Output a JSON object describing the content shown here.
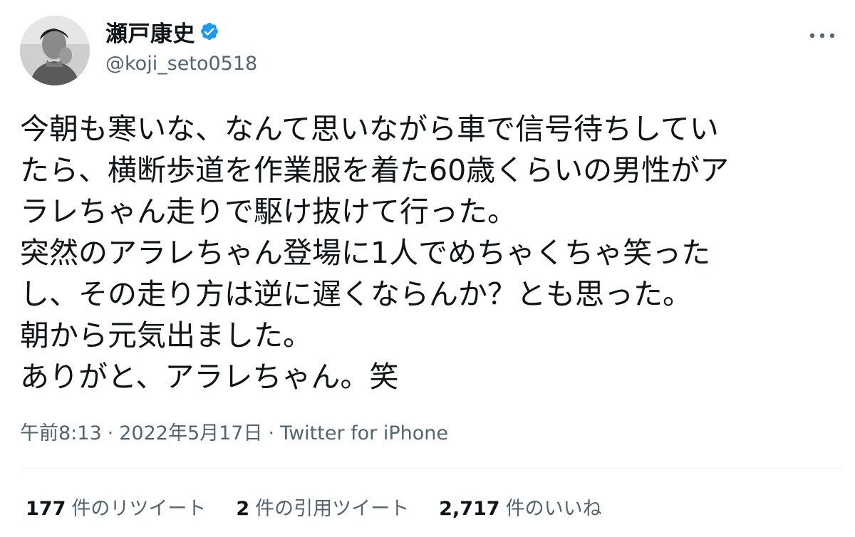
{
  "author": {
    "display_name": "瀬戸康史",
    "handle": "@koji_seto0518",
    "verified": true,
    "avatar_icon": "profile-photo-avatar",
    "verified_icon": "verified-badge-icon",
    "verified_color": "#1d9bf0"
  },
  "menu": {
    "more_icon": "more-options-icon"
  },
  "tweet": {
    "lines": [
      "今朝も寒いな、なんて思いながら車で信号待ちしてい",
      "たら、横断歩道を作業服を着た60歳くらいの男性がア",
      "ラレちゃん走りで駆け抜けて行った。",
      "突然のアラレちゃん登場に1人でめちゃくちゃ笑った",
      "し、その走り方は逆に遅くならんか？とも思った。",
      "朝から元気出ました。",
      "ありがと、アラレちゃん。笑"
    ]
  },
  "meta": {
    "time": "午前8:13",
    "date": "2022年5月17日",
    "source": "Twitter for iPhone",
    "separator": "·"
  },
  "stats": {
    "retweets_count": "177",
    "retweets_label": "件のリツイート",
    "quotes_count": "2",
    "quotes_label": "件の引用ツイート",
    "likes_count": "2,717",
    "likes_label": "件のいいね"
  },
  "colors": {
    "text_primary": "#0f1419",
    "text_secondary": "#536471",
    "divider": "#eff3f4"
  }
}
